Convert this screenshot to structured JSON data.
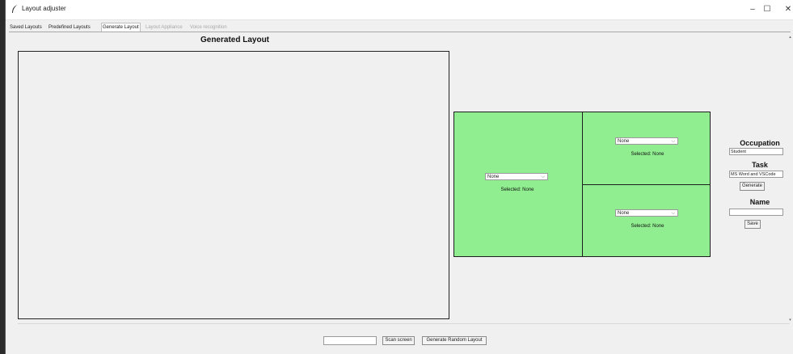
{
  "window": {
    "title": "Layout adjuster",
    "minimize_label": "–",
    "maximize_label": "☐",
    "close_label": "✕"
  },
  "tabs": [
    {
      "label": "Saved Layouts",
      "state": "normal"
    },
    {
      "label": "Predefined Layouts",
      "state": "normal"
    },
    {
      "label": "Generate Layout",
      "state": "active"
    },
    {
      "label": "Layout Appliance",
      "state": "disabled"
    },
    {
      "label": "Voice recognition",
      "state": "disabled"
    }
  ],
  "generated": {
    "title": "Generated Layout"
  },
  "layout_preview": {
    "fill_color": "#90ee90",
    "left": {
      "combo_value": "None",
      "selected_label": "Selected: None"
    },
    "top_right": {
      "combo_value": "None",
      "selected_label": "Selected: None"
    },
    "bottom_right": {
      "combo_value": "None",
      "selected_label": "Selected: None"
    }
  },
  "side_panel": {
    "occupation_label": "Occupation",
    "occupation_value": "Student",
    "task_label": "Task",
    "task_value": "MS Word and VSCode",
    "generate_label": "Generate",
    "name_label": "Name",
    "name_value": "",
    "save_label": "Save"
  },
  "bottom_bar": {
    "entry_value": "",
    "scan_label": "Scan screen",
    "random_label": "Generate Random Layout"
  },
  "icons": {
    "app": "feather-icon",
    "combo": "chevron-down-icon",
    "scroll_up": "scroll-up-arrow-icon",
    "scroll_down": "scroll-down-arrow-icon"
  }
}
